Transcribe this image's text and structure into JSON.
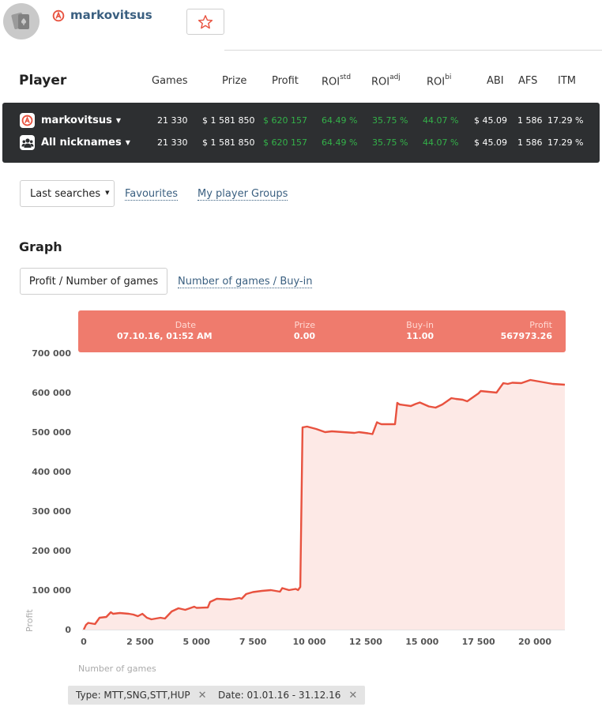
{
  "profile": {
    "username": "markovitsus",
    "icons": {
      "avatar": "card-player-icon",
      "brand": "A-logo-icon",
      "favourite": "star-outline-icon"
    },
    "accent": "#e8523f"
  },
  "player_table": {
    "title": "Player",
    "headers": {
      "games": "Games",
      "prize": "Prize",
      "profit": "Profit",
      "roi": "ROI",
      "roi_std": "std",
      "roi2": "ROI",
      "roi_adj": "adj",
      "roi3": "ROI",
      "roi_bi": "bi",
      "abi": "ABI",
      "afs": "AFS",
      "itm": "ITM"
    },
    "rows": [
      {
        "name": "markovitsus",
        "icon": "A-logo-icon",
        "games": "21 330",
        "prize": "$ 1 581 850",
        "profit": "$ 620 157",
        "roi_std": "64.49 %",
        "roi_adj": "35.75 %",
        "roi_bi": "44.07 %",
        "abi": "$ 45.09",
        "afs": "1 586",
        "itm": "17.29 %"
      },
      {
        "name": "All nicknames",
        "icon": "group-icon",
        "games": "21 330",
        "prize": "$ 1 581 850",
        "profit": "$ 620 157",
        "roi_std": "64.49 %",
        "roi_adj": "35.75 %",
        "roi_bi": "44.07 %",
        "abi": "$ 45.09",
        "afs": "1 586",
        "itm": "17.29 %"
      }
    ],
    "colors": {
      "box": "#2d2f31",
      "positive": "#33b249"
    }
  },
  "search_nav": {
    "last_searches": "Last searches",
    "favourites": "Favourites",
    "player_groups": "My player Groups"
  },
  "graph": {
    "title": "Graph",
    "active_mode": "Profit / Number of games",
    "other_mode": "Number of games / Buy-in",
    "tooltip": {
      "date_label": "Date",
      "date_value": "07.10.16, 01:52 AM",
      "prize_label": "Prize",
      "prize_value": "0.00",
      "buyin_label": "Buy-in",
      "buyin_value": "11.00",
      "profit_label": "Profit",
      "profit_value": "567973.26"
    }
  },
  "chart_data": {
    "type": "area",
    "title": "",
    "xlabel": "Number of games",
    "ylabel": "Profit",
    "xlim": [
      0,
      21330
    ],
    "ylim": [
      0,
      700000
    ],
    "x_ticks": [
      "0",
      "2 500",
      "5 000",
      "7 500",
      "10 000",
      "12 500",
      "15 000",
      "17 500",
      "20 000"
    ],
    "y_ticks": [
      "0",
      "100 000",
      "200 000",
      "300 000",
      "400 000",
      "500 000",
      "600 000",
      "700 000"
    ],
    "grid": false,
    "line_color": "#e8523f",
    "fill_color": "#fde9e6",
    "series": [
      {
        "x": [
          0,
          100,
          200,
          500,
          600,
          700,
          1000,
          1200,
          1300,
          1600,
          2000,
          2200,
          2400,
          2600,
          2800,
          3000,
          3400,
          3600,
          3800,
          3900,
          4200,
          4500,
          4900,
          5000,
          5500,
          5600,
          5900,
          6500,
          6900,
          7000,
          7200,
          7500,
          7900,
          8300,
          8700,
          8800,
          9100,
          9400,
          9500,
          9600,
          9700,
          9900,
          10300,
          10700,
          11000,
          11500,
          12000,
          12200,
          12600,
          12800,
          13000,
          13100,
          13200,
          13800,
          13900,
          14000,
          14500,
          14700,
          14900,
          15300,
          15600,
          15900,
          16300,
          16500,
          16800,
          17000,
          17500,
          17600,
          18300,
          18600,
          18800,
          19000,
          19400,
          19800,
          20200,
          20800,
          21330
        ],
        "y": [
          0,
          12000,
          17000,
          14000,
          22000,
          30000,
          32000,
          44000,
          40000,
          42000,
          40000,
          38000,
          34000,
          40000,
          30000,
          26000,
          30000,
          28000,
          40000,
          46000,
          54000,
          50000,
          58000,
          55000,
          56000,
          70000,
          78000,
          76000,
          80000,
          78000,
          90000,
          95000,
          98000,
          100000,
          96000,
          105000,
          100000,
          103000,
          100000,
          108000,
          512000,
          514000,
          508000,
          500000,
          502000,
          500000,
          498000,
          500000,
          497000,
          495000,
          525000,
          522000,
          520000,
          520000,
          574000,
          570000,
          566000,
          571000,
          575000,
          565000,
          562000,
          570000,
          586000,
          584000,
          582000,
          578000,
          598000,
          604000,
          600000,
          624000,
          622000,
          625000,
          624000,
          632000,
          628000,
          622000,
          620000
        ]
      }
    ]
  },
  "filters": [
    {
      "label": "Type: MTT,SNG,STT,HUP"
    },
    {
      "label": "Date: 01.01.16 - 31.12.16"
    }
  ],
  "close_glyph": "✕"
}
